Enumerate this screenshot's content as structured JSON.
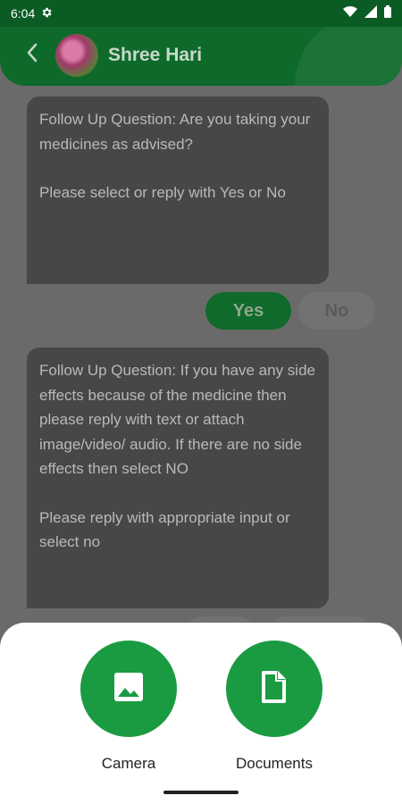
{
  "status_bar": {
    "time": "6:04"
  },
  "header": {
    "contact_name": "Shree Hari"
  },
  "messages": [
    {
      "line1": "Follow Up Question: Are you taking your medicines as advised?",
      "line2": "Please select or reply with Yes or No"
    },
    {
      "line1": "Follow Up Question: If you have any side effects because of the medicine then please reply with text or attach image/video/ audio. If there are no side effects then select NO",
      "line2": "Please reply with appropriate input or select no"
    }
  ],
  "replies": {
    "yes": "Yes",
    "no": "No"
  },
  "attach_sheet": {
    "camera_label": "Camera",
    "documents_label": "Documents"
  },
  "colors": {
    "header": "#0e6a2b",
    "action": "#1a9b41",
    "bubble": "#474747",
    "overlay": "#6a6a6a"
  }
}
